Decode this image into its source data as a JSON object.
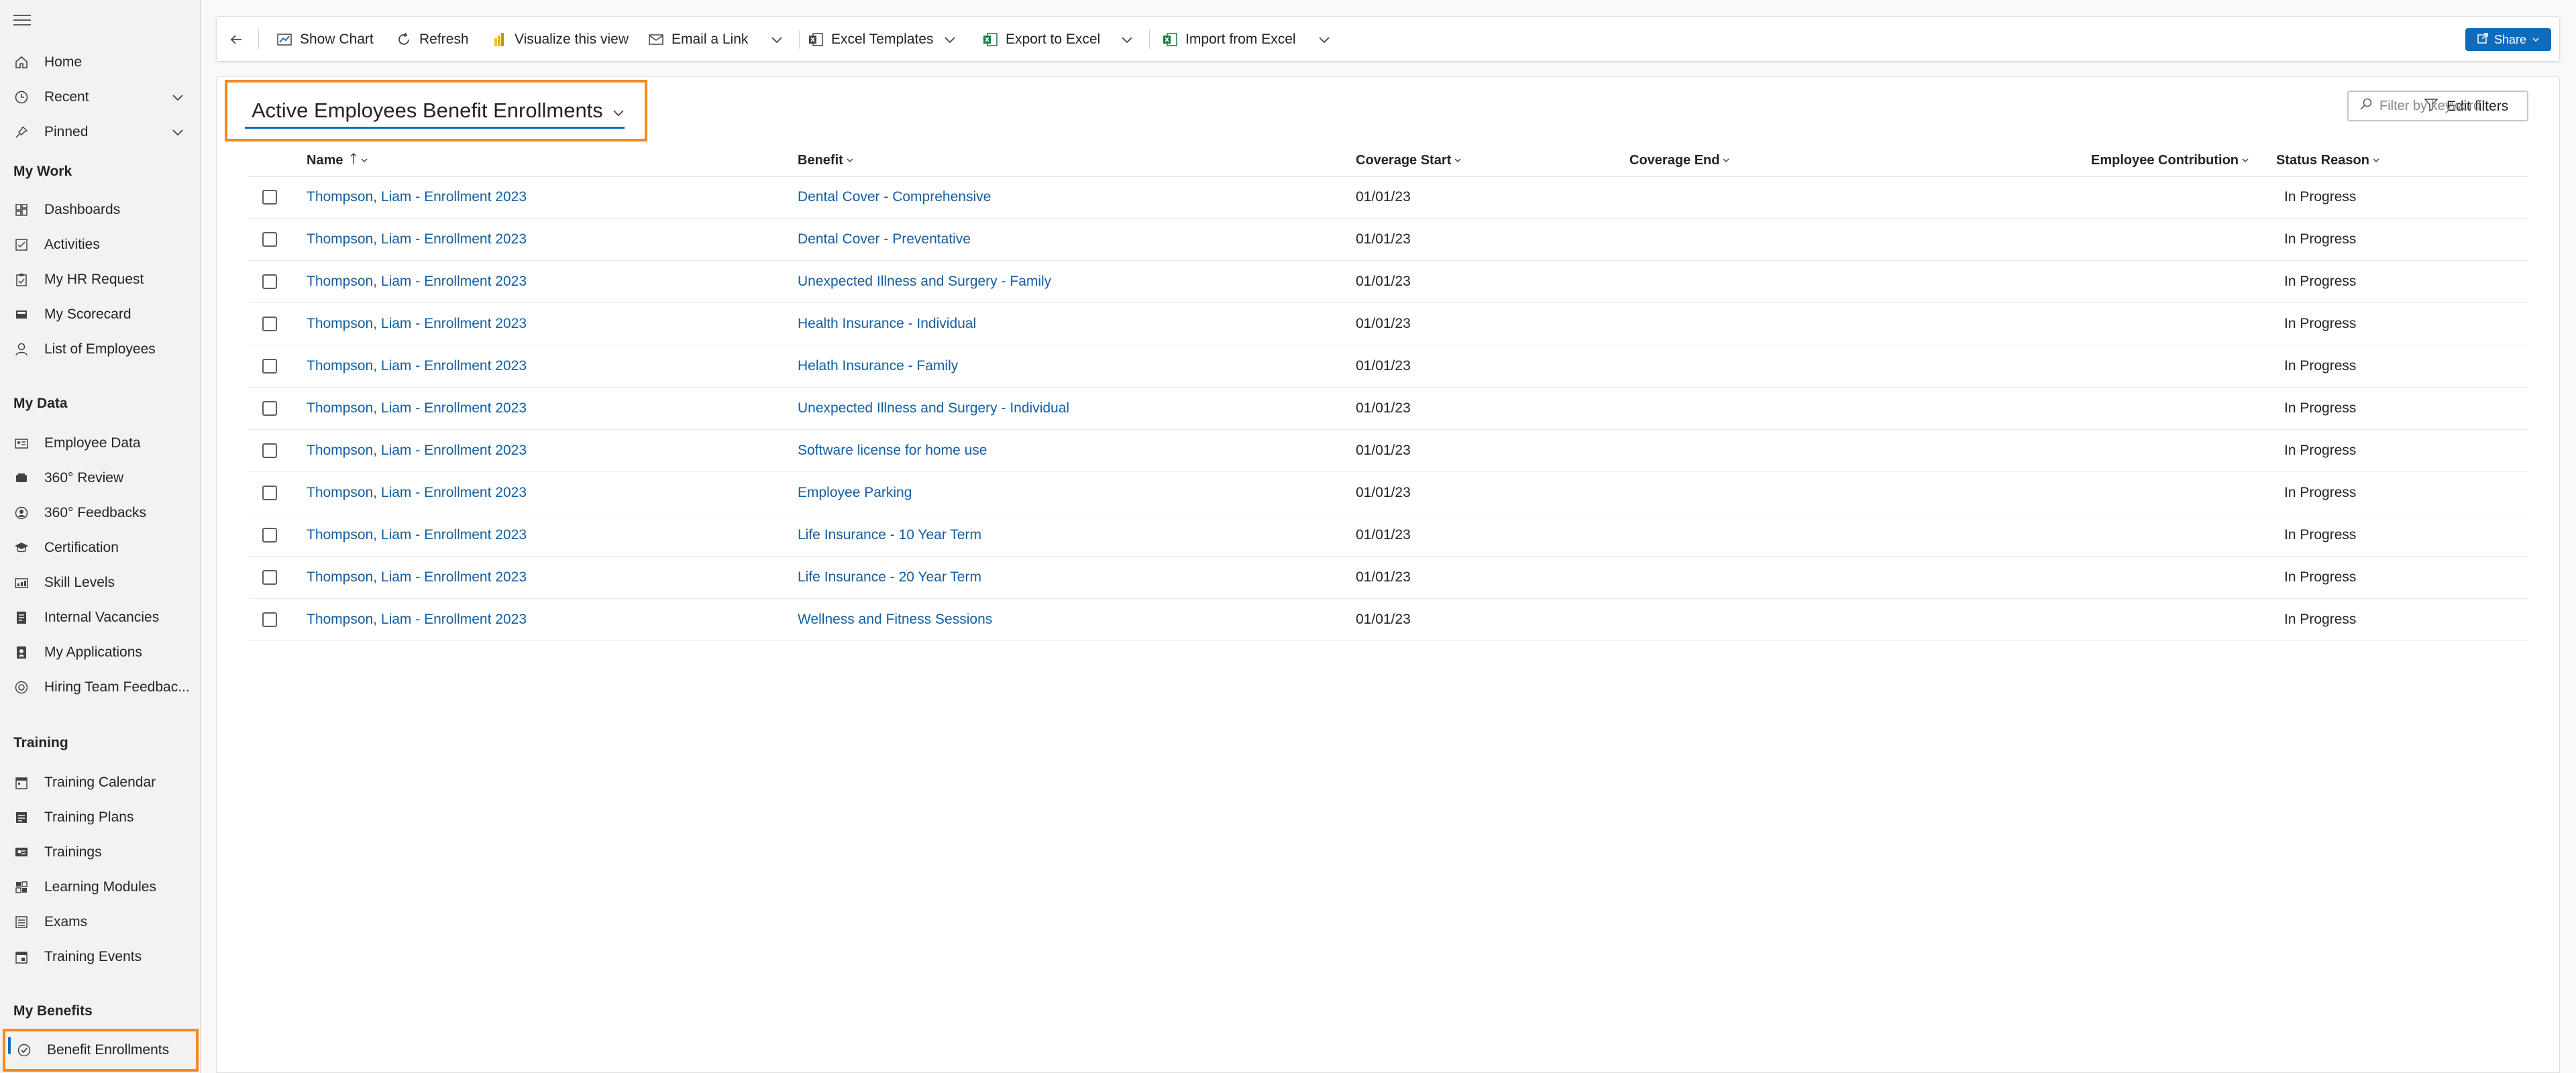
{
  "sidebar": {
    "top_items": [
      {
        "label": "Home",
        "icon": "home-icon"
      },
      {
        "label": "Recent",
        "icon": "clock-icon"
      },
      {
        "label": "Pinned",
        "icon": "pin-icon"
      }
    ],
    "sections": [
      {
        "title": "My Work",
        "items": [
          {
            "label": "Dashboards",
            "icon": "dashboard-icon"
          },
          {
            "label": "Activities",
            "icon": "activities-icon"
          },
          {
            "label": "My HR Request",
            "icon": "clipboard-icon"
          },
          {
            "label": "My Scorecard",
            "icon": "scorecard-icon"
          },
          {
            "label": "List of Employees",
            "icon": "person-icon"
          }
        ]
      },
      {
        "title": "My Data",
        "items": [
          {
            "label": "Employee Data",
            "icon": "id-card-icon"
          },
          {
            "label": "360° Review",
            "icon": "review-icon"
          },
          {
            "label": "360° Feedbacks",
            "icon": "feedback-icon"
          },
          {
            "label": "Certification",
            "icon": "graduation-cap-icon"
          },
          {
            "label": "Skill Levels",
            "icon": "skill-icon"
          },
          {
            "label": "Internal Vacancies",
            "icon": "document-icon"
          },
          {
            "label": "My Applications",
            "icon": "application-icon"
          },
          {
            "label": "Hiring Team Feedbac...",
            "icon": "hiring-feedback-icon"
          }
        ]
      },
      {
        "title": "Training",
        "items": [
          {
            "label": "Training Calendar",
            "icon": "calendar-icon"
          },
          {
            "label": "Training Plans",
            "icon": "plan-icon"
          },
          {
            "label": "Trainings",
            "icon": "training-icon"
          },
          {
            "label": "Learning Modules",
            "icon": "module-icon"
          },
          {
            "label": "Exams",
            "icon": "exam-icon"
          },
          {
            "label": "Training Events",
            "icon": "event-icon"
          }
        ]
      },
      {
        "title": "My Benefits",
        "items": [
          {
            "label": "Benefit Enrollments",
            "icon": "benefit-icon"
          }
        ]
      }
    ]
  },
  "toolbar": {
    "show_chart": "Show Chart",
    "refresh": "Refresh",
    "visualize": "Visualize this view",
    "email_link": "Email a Link",
    "excel_templates": "Excel Templates",
    "export_excel": "Export to Excel",
    "import_excel": "Import from Excel",
    "share": "Share"
  },
  "view": {
    "title": "Active Employees Benefit Enrollments",
    "edit_filters": "Edit filters",
    "filter_placeholder": "Filter by keyword"
  },
  "grid": {
    "columns": [
      "Name",
      "Benefit",
      "Coverage Start",
      "Coverage End",
      "Employee Contribution",
      "Status Reason"
    ],
    "rows": [
      {
        "name": "Thompson, Liam - Enrollment 2023",
        "benefit": "Dental Cover - Comprehensive",
        "start": "01/01/23",
        "end": "",
        "contribution": "",
        "status": "In Progress"
      },
      {
        "name": "Thompson, Liam - Enrollment 2023",
        "benefit": "Dental Cover - Preventative",
        "start": "01/01/23",
        "end": "",
        "contribution": "",
        "status": "In Progress"
      },
      {
        "name": "Thompson, Liam - Enrollment 2023",
        "benefit": "Unexpected Illness and Surgery - Family",
        "start": "01/01/23",
        "end": "",
        "contribution": "",
        "status": "In Progress"
      },
      {
        "name": "Thompson, Liam - Enrollment 2023",
        "benefit": "Health Insurance - Individual",
        "start": "01/01/23",
        "end": "",
        "contribution": "",
        "status": "In Progress"
      },
      {
        "name": "Thompson, Liam - Enrollment 2023",
        "benefit": "Helath Insurance - Family",
        "start": "01/01/23",
        "end": "",
        "contribution": "",
        "status": "In Progress"
      },
      {
        "name": "Thompson, Liam - Enrollment 2023",
        "benefit": "Unexpected Illness and Surgery - Individual",
        "start": "01/01/23",
        "end": "",
        "contribution": "",
        "status": "In Progress"
      },
      {
        "name": "Thompson, Liam - Enrollment 2023",
        "benefit": "Software license for home use",
        "start": "01/01/23",
        "end": "",
        "contribution": "",
        "status": "In Progress"
      },
      {
        "name": "Thompson, Liam - Enrollment 2023",
        "benefit": "Employee Parking",
        "start": "01/01/23",
        "end": "",
        "contribution": "",
        "status": "In Progress"
      },
      {
        "name": "Thompson, Liam - Enrollment 2023",
        "benefit": "Life Insurance - 10 Year Term",
        "start": "01/01/23",
        "end": "",
        "contribution": "",
        "status": "In Progress"
      },
      {
        "name": "Thompson, Liam - Enrollment 2023",
        "benefit": "Life Insurance - 20 Year Term",
        "start": "01/01/23",
        "end": "",
        "contribution": "",
        "status": "In Progress"
      },
      {
        "name": "Thompson, Liam - Enrollment 2023",
        "benefit": "Wellness and Fitness Sessions",
        "start": "01/01/23",
        "end": "",
        "contribution": "",
        "status": "In Progress"
      }
    ]
  },
  "colors": {
    "accent": "#0f6cbd",
    "link": "#115ea3",
    "highlight": "#f28b1d"
  }
}
